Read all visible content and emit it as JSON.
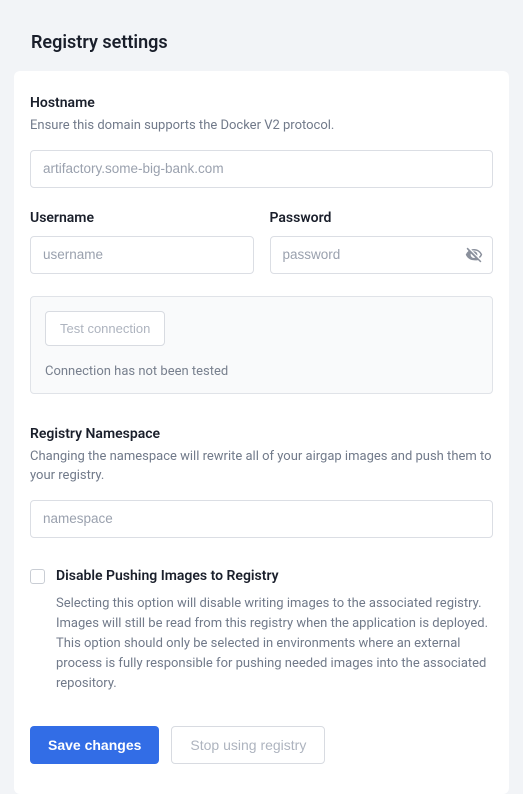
{
  "page": {
    "title": "Registry settings"
  },
  "hostname": {
    "label": "Hostname",
    "help": "Ensure this domain supports the Docker V2 protocol.",
    "placeholder": "artifactory.some-big-bank.com",
    "value": ""
  },
  "username": {
    "label": "Username",
    "placeholder": "username",
    "value": ""
  },
  "password": {
    "label": "Password",
    "placeholder": "password",
    "value": ""
  },
  "test": {
    "button_label": "Test connection",
    "status": "Connection has not been tested"
  },
  "namespace": {
    "label": "Registry Namespace",
    "help": "Changing the namespace will rewrite all of your airgap images and push them to your registry.",
    "placeholder": "namespace",
    "value": ""
  },
  "disable_push": {
    "label": "Disable Pushing Images to Registry",
    "help": "Selecting this option will disable writing images to the associated registry. Images will still be read from this registry when the application is deployed. This option should only be selected in environments where an external process is fully responsible for pushing needed images into the associated repository.",
    "checked": false
  },
  "actions": {
    "save_label": "Save changes",
    "stop_label": "Stop using registry"
  }
}
